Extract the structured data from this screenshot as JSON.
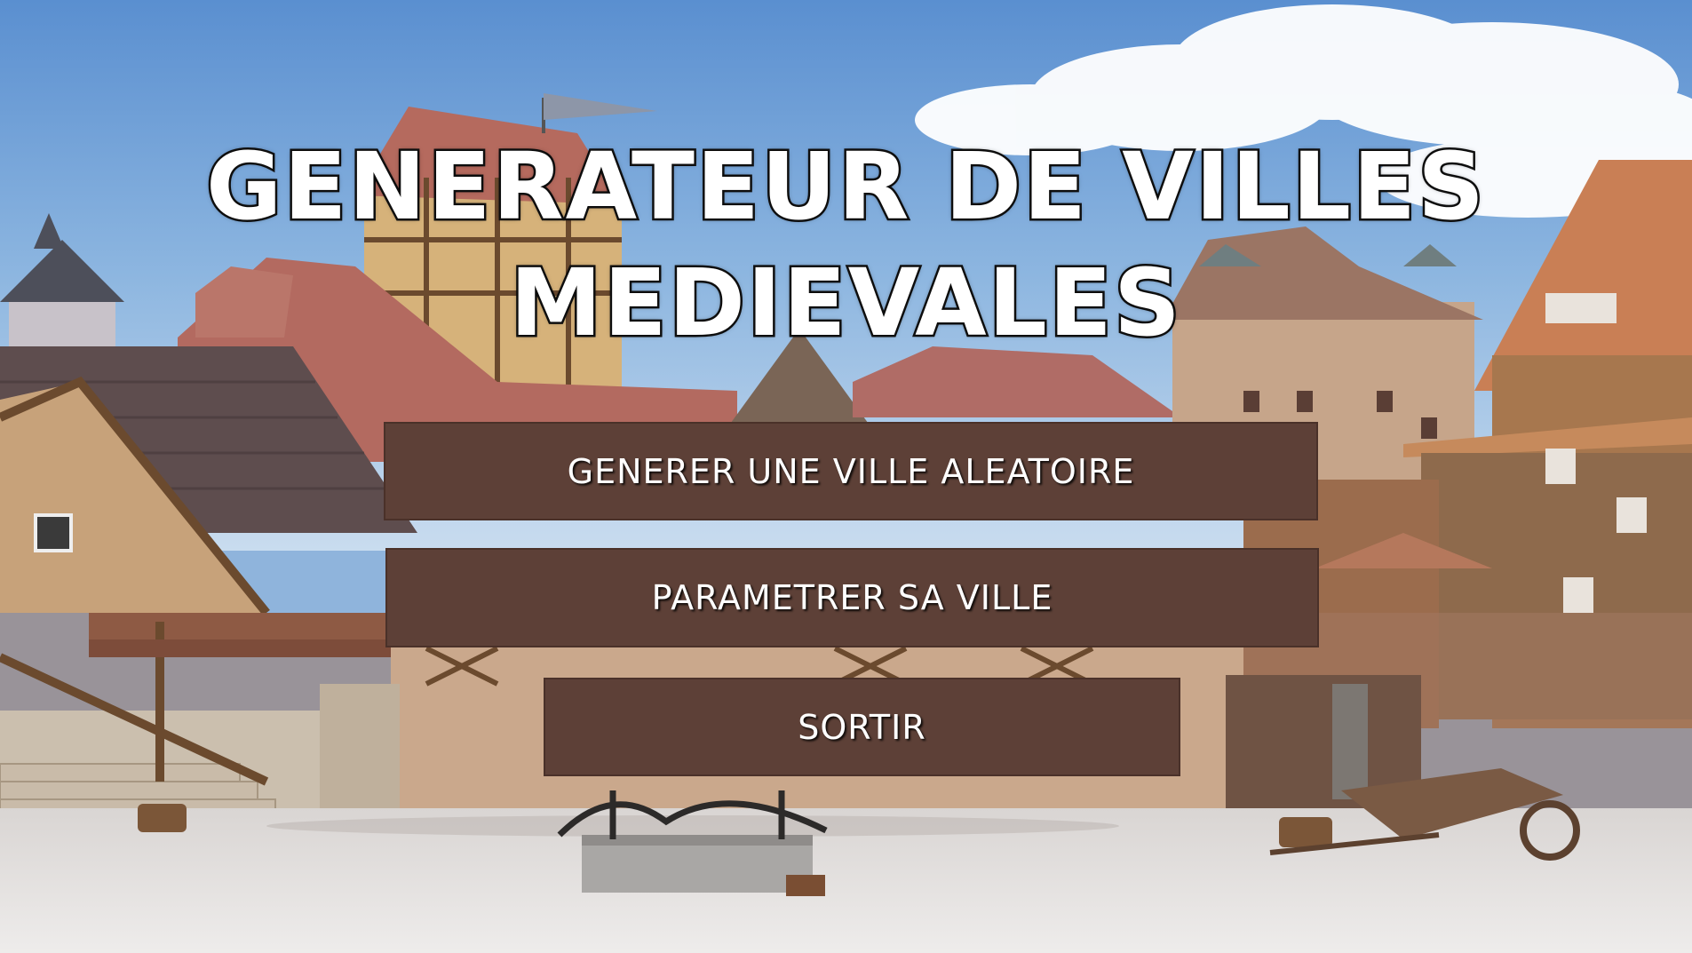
{
  "menu": {
    "title_line1": "GENERATEUR DE VILLES",
    "title_line2": "MEDIEVALES",
    "buttons": {
      "random_city": "GENERER UNE VILLE ALEATOIRE",
      "configure_city": "PARAMETRER SA VILLE",
      "quit": "SORTIR"
    }
  },
  "colors": {
    "button_bg": "#5d4037",
    "button_text": "#ffffff",
    "title_fill": "#ffffff",
    "title_outline": "#111111"
  }
}
